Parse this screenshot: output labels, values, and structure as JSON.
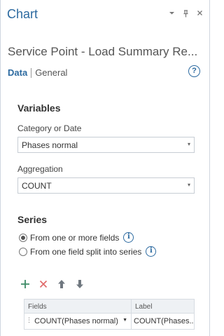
{
  "pane": {
    "title": "Chart",
    "subtitle": "Service Point - Load Summary Re...",
    "controls": {
      "menu": "▾",
      "pin": "📌",
      "close": "✕"
    }
  },
  "tabs": {
    "data": "Data",
    "general": "General"
  },
  "variables": {
    "heading": "Variables",
    "category_label": "Category or Date",
    "category_value": "Phases normal",
    "aggregation_label": "Aggregation",
    "aggregation_value": "COUNT"
  },
  "series": {
    "heading": "Series",
    "option1": "From one or more fields",
    "option2": "From one field split into series",
    "selected": "option1"
  },
  "grid": {
    "headers": [
      "Fields",
      "Label"
    ],
    "rows": [
      {
        "field": "COUNT(Phases normal)",
        "label": "COUNT(Phases..."
      }
    ]
  },
  "colors": {
    "accent": "#2c6aa0",
    "add_green": "#3d8b66",
    "remove_red": "#e06a6a"
  }
}
